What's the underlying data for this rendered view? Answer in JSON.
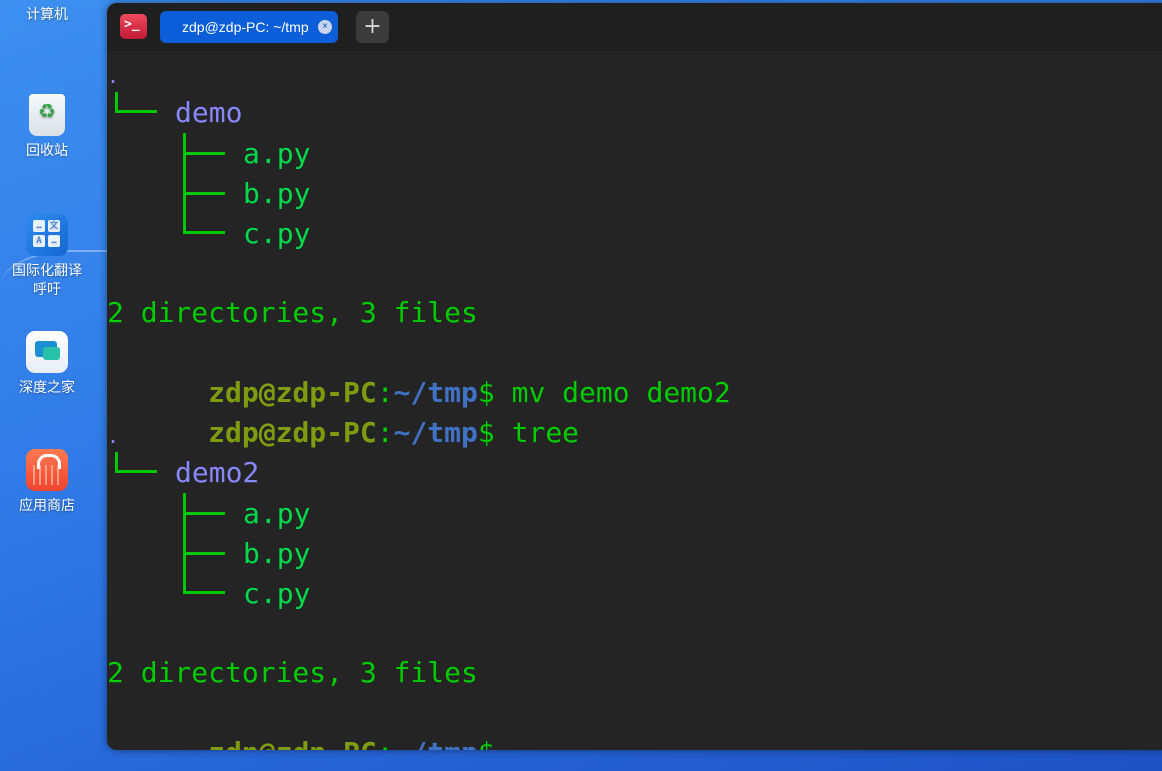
{
  "desktop": {
    "icons": [
      {
        "label": "计算机",
        "icon": "computer-icon"
      },
      {
        "label": "回收站",
        "icon": "trash-icon"
      },
      {
        "label": "国际化翻译\n呼吁",
        "icon": "translate-icon"
      },
      {
        "label": "深度之家",
        "icon": "deepin-home-icon"
      },
      {
        "label": "应用商店",
        "icon": "app-store-icon"
      }
    ]
  },
  "terminal": {
    "tab_title": "zdp@zdp-PC: ~/tmp",
    "new_tab_label": "+",
    "output": {
      "tree1_root": ".",
      "tree1_dir": "demo",
      "tree1_files": [
        "a.py",
        "b.py",
        "c.py"
      ],
      "summary1": "2 directories, 3 files",
      "prompt_user": "zdp@zdp-PC",
      "prompt_colon": ":",
      "prompt_path": "~/tmp",
      "prompt_dollar": "$",
      "cmd1": " mv demo demo2",
      "cmd2": " tree",
      "tree2_root": ".",
      "tree2_dir": "demo2",
      "tree2_files": [
        "a.py",
        "b.py",
        "c.py"
      ],
      "summary2": "2 directories, 3 files"
    }
  }
}
